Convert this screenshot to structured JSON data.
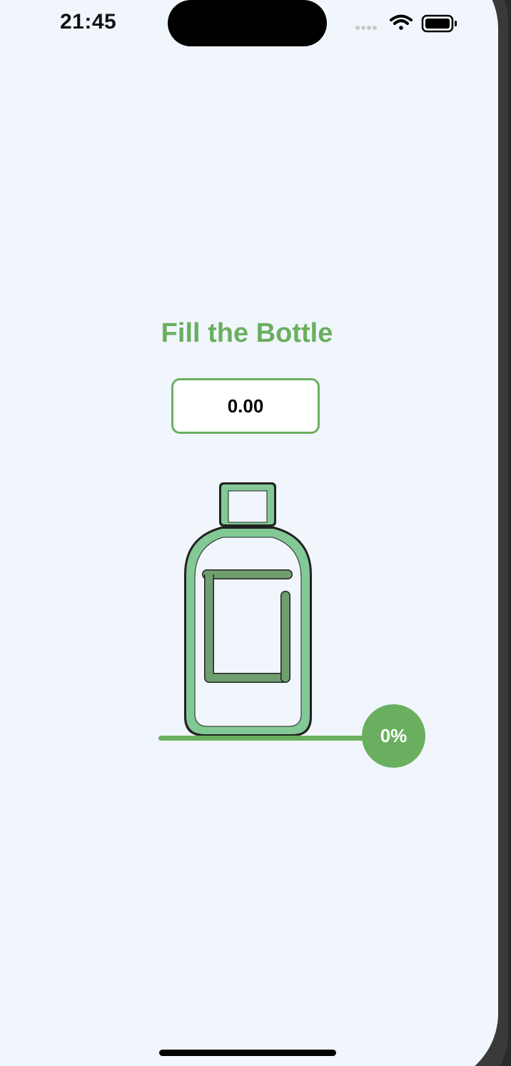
{
  "status_bar": {
    "time": "21:45",
    "icons": [
      "signal-dots-icon",
      "wifi-icon",
      "battery-icon"
    ]
  },
  "main": {
    "title": "Fill the Bottle",
    "value": "0.00",
    "fill_percent": 0
  },
  "slider": {
    "label": "0%",
    "value": 0
  },
  "colors": {
    "accent": "#6aaf5f",
    "bottle_outline": "#82c995",
    "label_outline": "#6f9f6e",
    "background": "#f1f6fd"
  }
}
